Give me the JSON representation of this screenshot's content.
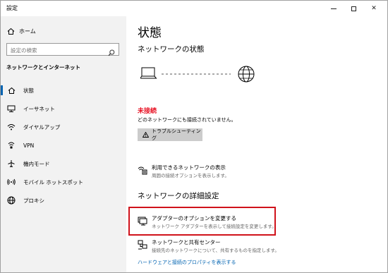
{
  "window": {
    "title": "設定"
  },
  "sidebar": {
    "home_label": "ホーム",
    "search_placeholder": "設定の検索",
    "section_title": "ネットワークとインターネット",
    "items": [
      {
        "label": "状態",
        "icon": "home-status-icon"
      },
      {
        "label": "イーサネット",
        "icon": "ethernet-icon"
      },
      {
        "label": "ダイヤルアップ",
        "icon": "dialup-icon"
      },
      {
        "label": "VPN",
        "icon": "vpn-icon"
      },
      {
        "label": "機内モード",
        "icon": "airplane-icon"
      },
      {
        "label": "モバイル ホットスポット",
        "icon": "hotspot-icon"
      },
      {
        "label": "プロキシ",
        "icon": "globe-icon"
      }
    ]
  },
  "main": {
    "title": "状態",
    "network_status_heading": "ネットワークの状態",
    "status_title": "未接続",
    "status_desc": "どのネットワークにも接続されていません。",
    "troubleshoot_label": "トラブルシューティング",
    "available_networks": {
      "title": "利用できるネットワークの表示",
      "desc": "周囲の接続オプションを表示します。"
    },
    "advanced_heading": "ネットワークの詳細設定",
    "adapter_options": {
      "title": "アダプターのオプションを変更する",
      "desc": "ネットワーク アダプターを表示して接続設定を変更します。"
    },
    "sharing_center": {
      "title": "ネットワークと共有センター",
      "desc": "接続先のネットワークについて、共有するものを指定します。"
    },
    "hardware_link": "ハードウェアと接続のプロパティを表示する"
  },
  "colors": {
    "accent": "#0063b1",
    "error": "#e81123",
    "highlight": "#d0121b",
    "sidebar_bg": "#f2f2f2"
  }
}
